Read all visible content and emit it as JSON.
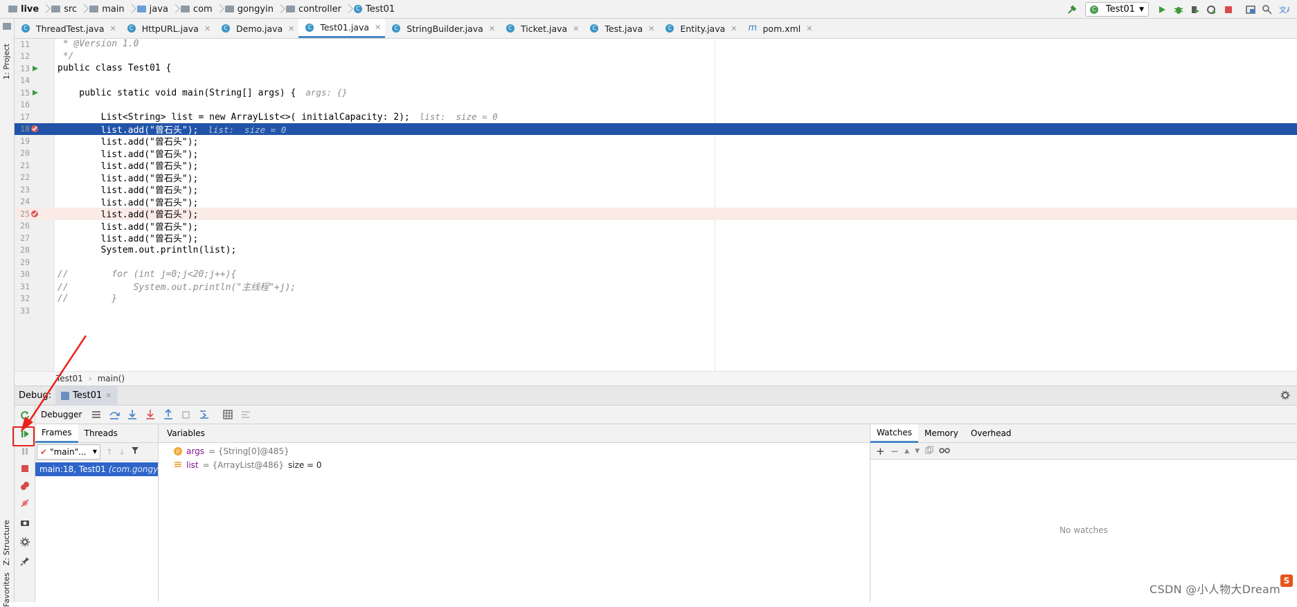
{
  "breadcrumb": [
    "live",
    "src",
    "main",
    "java",
    "com",
    "gongyin",
    "controller",
    "Test01"
  ],
  "toolbar": {
    "run_config": "Test01"
  },
  "left_tool_windows": {
    "project": "1: Project",
    "structure": "Z: Structure",
    "favorites": "Favorites"
  },
  "editor_tabs": [
    {
      "label": "ThreadTest.java",
      "icon": "class-icon"
    },
    {
      "label": "HttpURL.java",
      "icon": "class-icon"
    },
    {
      "label": "Demo.java",
      "icon": "class-icon"
    },
    {
      "label": "Test01.java",
      "icon": "class-icon",
      "active": true
    },
    {
      "label": "StringBuilder.java",
      "icon": "class-icon"
    },
    {
      "label": "Ticket.java",
      "icon": "class-icon"
    },
    {
      "label": "Test.java",
      "icon": "class-icon"
    },
    {
      "label": "Entity.java",
      "icon": "class-icon"
    },
    {
      "label": "pom.xml",
      "icon": "maven-icon"
    }
  ],
  "code_lines": [
    {
      "n": "11",
      "text": " * @Version 1.0"
    },
    {
      "n": "12",
      "text": " */"
    },
    {
      "n": "13",
      "text": "public class Test01 {"
    },
    {
      "n": "14",
      "text": ""
    },
    {
      "n": "15",
      "text": "    public static void main(String[] args) {",
      "hint": "args: {}"
    },
    {
      "n": "16",
      "text": ""
    },
    {
      "n": "17",
      "text": "        List<String> list = new ArrayList<>( initialCapacity: 2);",
      "hint": "list:  size = 0"
    },
    {
      "n": "18",
      "text": "        list.add(\"曾石头\");",
      "hint": "list:  size = 0"
    },
    {
      "n": "19",
      "text": "        list.add(\"曾石头\");"
    },
    {
      "n": "20",
      "text": "        list.add(\"曾石头\");"
    },
    {
      "n": "21",
      "text": "        list.add(\"曾石头\");"
    },
    {
      "n": "22",
      "text": "        list.add(\"曾石头\");"
    },
    {
      "n": "23",
      "text": "        list.add(\"曾石头\");"
    },
    {
      "n": "24",
      "text": "        list.add(\"曾石头\");"
    },
    {
      "n": "25",
      "text": "        list.add(\"曾石头\");"
    },
    {
      "n": "26",
      "text": "        list.add(\"曾石头\");"
    },
    {
      "n": "27",
      "text": "        list.add(\"曾石头\");"
    },
    {
      "n": "28",
      "text": "        System.out.println(list);"
    },
    {
      "n": "29",
      "text": ""
    },
    {
      "n": "30",
      "text": "//        for (int j=0;j<20;j++){"
    },
    {
      "n": "31",
      "text": "//            System.out.println(\"主线程\"+j);"
    },
    {
      "n": "32",
      "text": "//        }"
    },
    {
      "n": "33",
      "text": ""
    }
  ],
  "editor_breadcrumb": [
    "Test01",
    "main()"
  ],
  "debug": {
    "label": "Debug:",
    "session_tab": "Test01",
    "toolbar_label": "Debugger",
    "subtabs": [
      "Frames",
      "Threads"
    ],
    "thread_select": "\"main\"...",
    "frame": {
      "text": "main:18, Test01",
      "pkg": "(com.gongyin"
    },
    "variables_title": "Variables",
    "variables": [
      {
        "icon": "p",
        "name": "args",
        "value": "= {String[0]@485}",
        "extra": ""
      },
      {
        "icon": "list",
        "name": "list",
        "value": "= {ArrayList@486}",
        "extra": "size = 0"
      }
    ],
    "right_tabs": [
      "Watches",
      "Memory",
      "Overhead"
    ],
    "no_watches": "No watches"
  },
  "watermark": "CSDN @小人物大Dream"
}
